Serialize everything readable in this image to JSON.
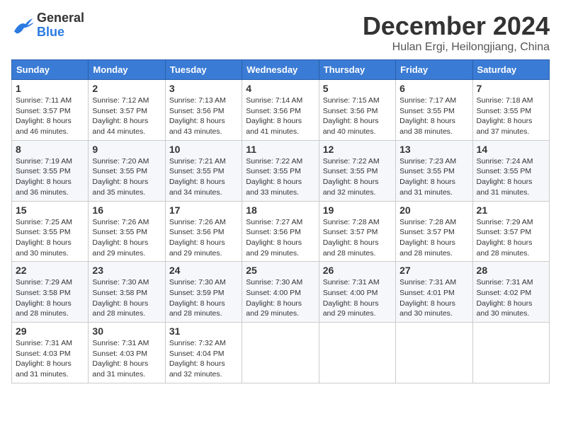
{
  "logo": {
    "general": "General",
    "blue": "Blue"
  },
  "title": "December 2024",
  "location": "Hulan Ergi, Heilongjiang, China",
  "days_of_week": [
    "Sunday",
    "Monday",
    "Tuesday",
    "Wednesday",
    "Thursday",
    "Friday",
    "Saturday"
  ],
  "weeks": [
    [
      {
        "day": "1",
        "sunrise": "7:11 AM",
        "sunset": "3:57 PM",
        "daylight": "8 hours and 46 minutes."
      },
      {
        "day": "2",
        "sunrise": "7:12 AM",
        "sunset": "3:57 PM",
        "daylight": "8 hours and 44 minutes."
      },
      {
        "day": "3",
        "sunrise": "7:13 AM",
        "sunset": "3:56 PM",
        "daylight": "8 hours and 43 minutes."
      },
      {
        "day": "4",
        "sunrise": "7:14 AM",
        "sunset": "3:56 PM",
        "daylight": "8 hours and 41 minutes."
      },
      {
        "day": "5",
        "sunrise": "7:15 AM",
        "sunset": "3:56 PM",
        "daylight": "8 hours and 40 minutes."
      },
      {
        "day": "6",
        "sunrise": "7:17 AM",
        "sunset": "3:55 PM",
        "daylight": "8 hours and 38 minutes."
      },
      {
        "day": "7",
        "sunrise": "7:18 AM",
        "sunset": "3:55 PM",
        "daylight": "8 hours and 37 minutes."
      }
    ],
    [
      {
        "day": "8",
        "sunrise": "7:19 AM",
        "sunset": "3:55 PM",
        "daylight": "8 hours and 36 minutes."
      },
      {
        "day": "9",
        "sunrise": "7:20 AM",
        "sunset": "3:55 PM",
        "daylight": "8 hours and 35 minutes."
      },
      {
        "day": "10",
        "sunrise": "7:21 AM",
        "sunset": "3:55 PM",
        "daylight": "8 hours and 34 minutes."
      },
      {
        "day": "11",
        "sunrise": "7:22 AM",
        "sunset": "3:55 PM",
        "daylight": "8 hours and 33 minutes."
      },
      {
        "day": "12",
        "sunrise": "7:22 AM",
        "sunset": "3:55 PM",
        "daylight": "8 hours and 32 minutes."
      },
      {
        "day": "13",
        "sunrise": "7:23 AM",
        "sunset": "3:55 PM",
        "daylight": "8 hours and 31 minutes."
      },
      {
        "day": "14",
        "sunrise": "7:24 AM",
        "sunset": "3:55 PM",
        "daylight": "8 hours and 31 minutes."
      }
    ],
    [
      {
        "day": "15",
        "sunrise": "7:25 AM",
        "sunset": "3:55 PM",
        "daylight": "8 hours and 30 minutes."
      },
      {
        "day": "16",
        "sunrise": "7:26 AM",
        "sunset": "3:55 PM",
        "daylight": "8 hours and 29 minutes."
      },
      {
        "day": "17",
        "sunrise": "7:26 AM",
        "sunset": "3:56 PM",
        "daylight": "8 hours and 29 minutes."
      },
      {
        "day": "18",
        "sunrise": "7:27 AM",
        "sunset": "3:56 PM",
        "daylight": "8 hours and 29 minutes."
      },
      {
        "day": "19",
        "sunrise": "7:28 AM",
        "sunset": "3:57 PM",
        "daylight": "8 hours and 28 minutes."
      },
      {
        "day": "20",
        "sunrise": "7:28 AM",
        "sunset": "3:57 PM",
        "daylight": "8 hours and 28 minutes."
      },
      {
        "day": "21",
        "sunrise": "7:29 AM",
        "sunset": "3:57 PM",
        "daylight": "8 hours and 28 minutes."
      }
    ],
    [
      {
        "day": "22",
        "sunrise": "7:29 AM",
        "sunset": "3:58 PM",
        "daylight": "8 hours and 28 minutes."
      },
      {
        "day": "23",
        "sunrise": "7:30 AM",
        "sunset": "3:58 PM",
        "daylight": "8 hours and 28 minutes."
      },
      {
        "day": "24",
        "sunrise": "7:30 AM",
        "sunset": "3:59 PM",
        "daylight": "8 hours and 28 minutes."
      },
      {
        "day": "25",
        "sunrise": "7:30 AM",
        "sunset": "4:00 PM",
        "daylight": "8 hours and 29 minutes."
      },
      {
        "day": "26",
        "sunrise": "7:31 AM",
        "sunset": "4:00 PM",
        "daylight": "8 hours and 29 minutes."
      },
      {
        "day": "27",
        "sunrise": "7:31 AM",
        "sunset": "4:01 PM",
        "daylight": "8 hours and 30 minutes."
      },
      {
        "day": "28",
        "sunrise": "7:31 AM",
        "sunset": "4:02 PM",
        "daylight": "8 hours and 30 minutes."
      }
    ],
    [
      {
        "day": "29",
        "sunrise": "7:31 AM",
        "sunset": "4:03 PM",
        "daylight": "8 hours and 31 minutes."
      },
      {
        "day": "30",
        "sunrise": "7:31 AM",
        "sunset": "4:03 PM",
        "daylight": "8 hours and 31 minutes."
      },
      {
        "day": "31",
        "sunrise": "7:32 AM",
        "sunset": "4:04 PM",
        "daylight": "8 hours and 32 minutes."
      },
      null,
      null,
      null,
      null
    ]
  ]
}
